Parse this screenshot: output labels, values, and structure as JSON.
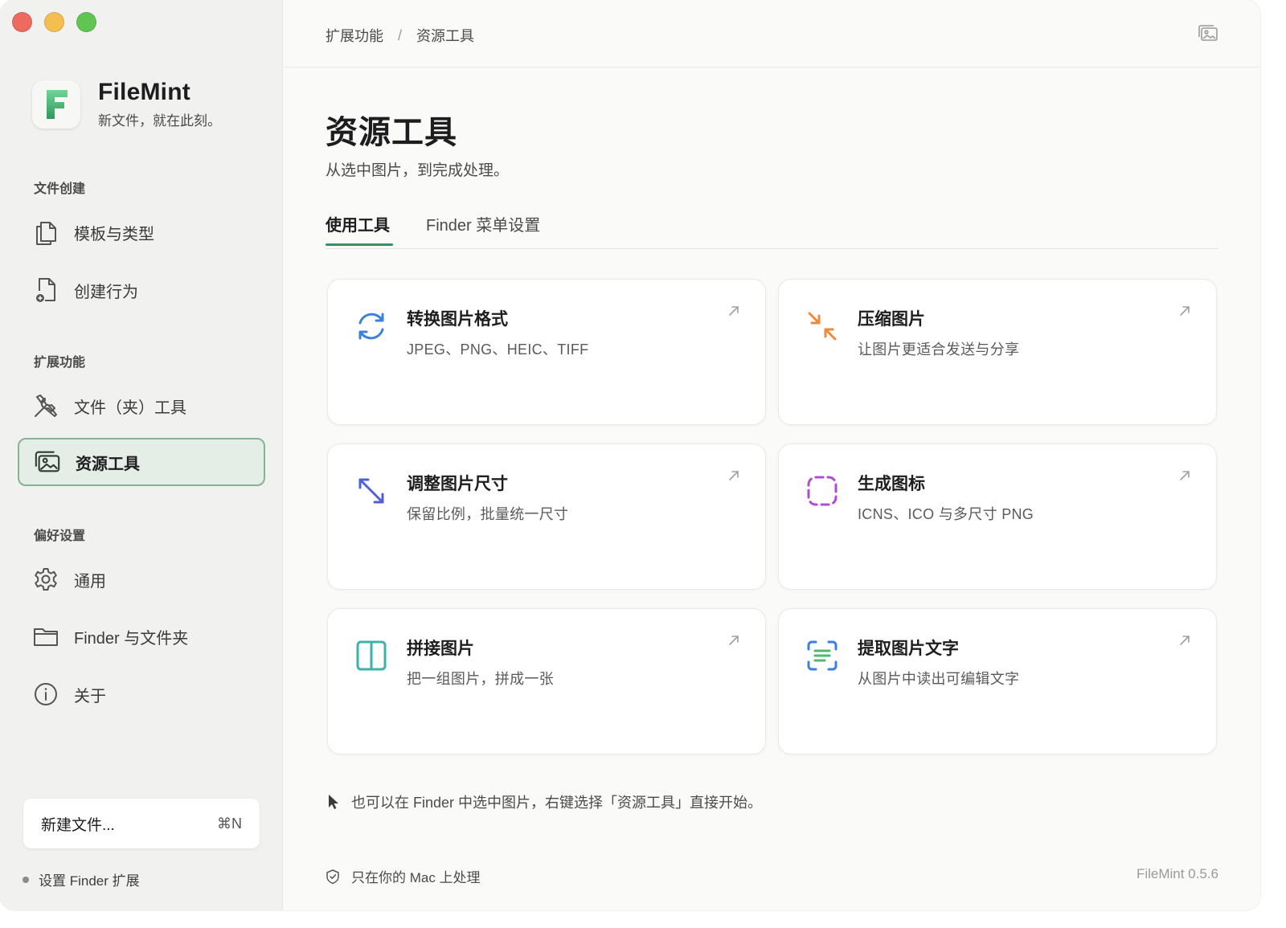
{
  "app": {
    "name": "FileMint",
    "tagline": "新文件，就在此刻。",
    "version": "FileMint 0.5.6"
  },
  "sidebar": {
    "sections": [
      {
        "label": "文件创建",
        "items": [
          {
            "label": "模板与类型",
            "icon": "documents-icon"
          },
          {
            "label": "创建行为",
            "icon": "document-add-icon"
          }
        ]
      },
      {
        "label": "扩展功能",
        "items": [
          {
            "label": "文件（夹）工具",
            "icon": "tools-icon"
          },
          {
            "label": "资源工具",
            "icon": "photos-icon",
            "active": true
          }
        ]
      },
      {
        "label": "偏好设置",
        "items": [
          {
            "label": "通用",
            "icon": "gear-icon"
          },
          {
            "label": "Finder 与文件夹",
            "icon": "folder-icon"
          },
          {
            "label": "关于",
            "icon": "info-icon"
          }
        ]
      }
    ],
    "new_file": {
      "label": "新建文件...",
      "shortcut": "⌘N"
    },
    "finder_ext": "设置 Finder 扩展"
  },
  "breadcrumb": [
    "扩展功能",
    "资源工具"
  ],
  "breadcrumb_sep": "/",
  "page": {
    "title": "资源工具",
    "subtitle": "从选中图片，到完成处理。"
  },
  "tabs": [
    {
      "label": "使用工具",
      "active": true
    },
    {
      "label": "Finder 菜单设置",
      "active": false
    }
  ],
  "cards": [
    {
      "title": "转换图片格式",
      "desc": "JPEG、PNG、HEIC、TIFF",
      "icon": "convert-icon",
      "color": "#3b7fe0"
    },
    {
      "title": "压缩图片",
      "desc": "让图片更适合发送与分享",
      "icon": "compress-icon",
      "color": "#ee8a3a"
    },
    {
      "title": "调整图片尺寸",
      "desc": "保留比例，批量统一尺寸",
      "icon": "resize-icon",
      "color": "#4f5fd6"
    },
    {
      "title": "生成图标",
      "desc": "ICNS、ICO 与多尺寸 PNG",
      "icon": "icon-frame-icon",
      "color": "#b24ad6"
    },
    {
      "title": "拼接图片",
      "desc": "把一组图片，拼成一张",
      "icon": "split-panel-icon",
      "color": "#3bb3a7"
    },
    {
      "title": "提取图片文字",
      "desc": "从图片中读出可编辑文字",
      "icon": "text-scan-icon",
      "color": "#3b7fe0"
    }
  ],
  "hint": "也可以在 Finder 中选中图片，右键选择「资源工具」直接开始。",
  "footer": {
    "privacy": "只在你的 Mac 上处理"
  },
  "colors": {
    "accent": "#3a9060",
    "active_bg": "#e4ede6",
    "active_border": "#86b393"
  }
}
